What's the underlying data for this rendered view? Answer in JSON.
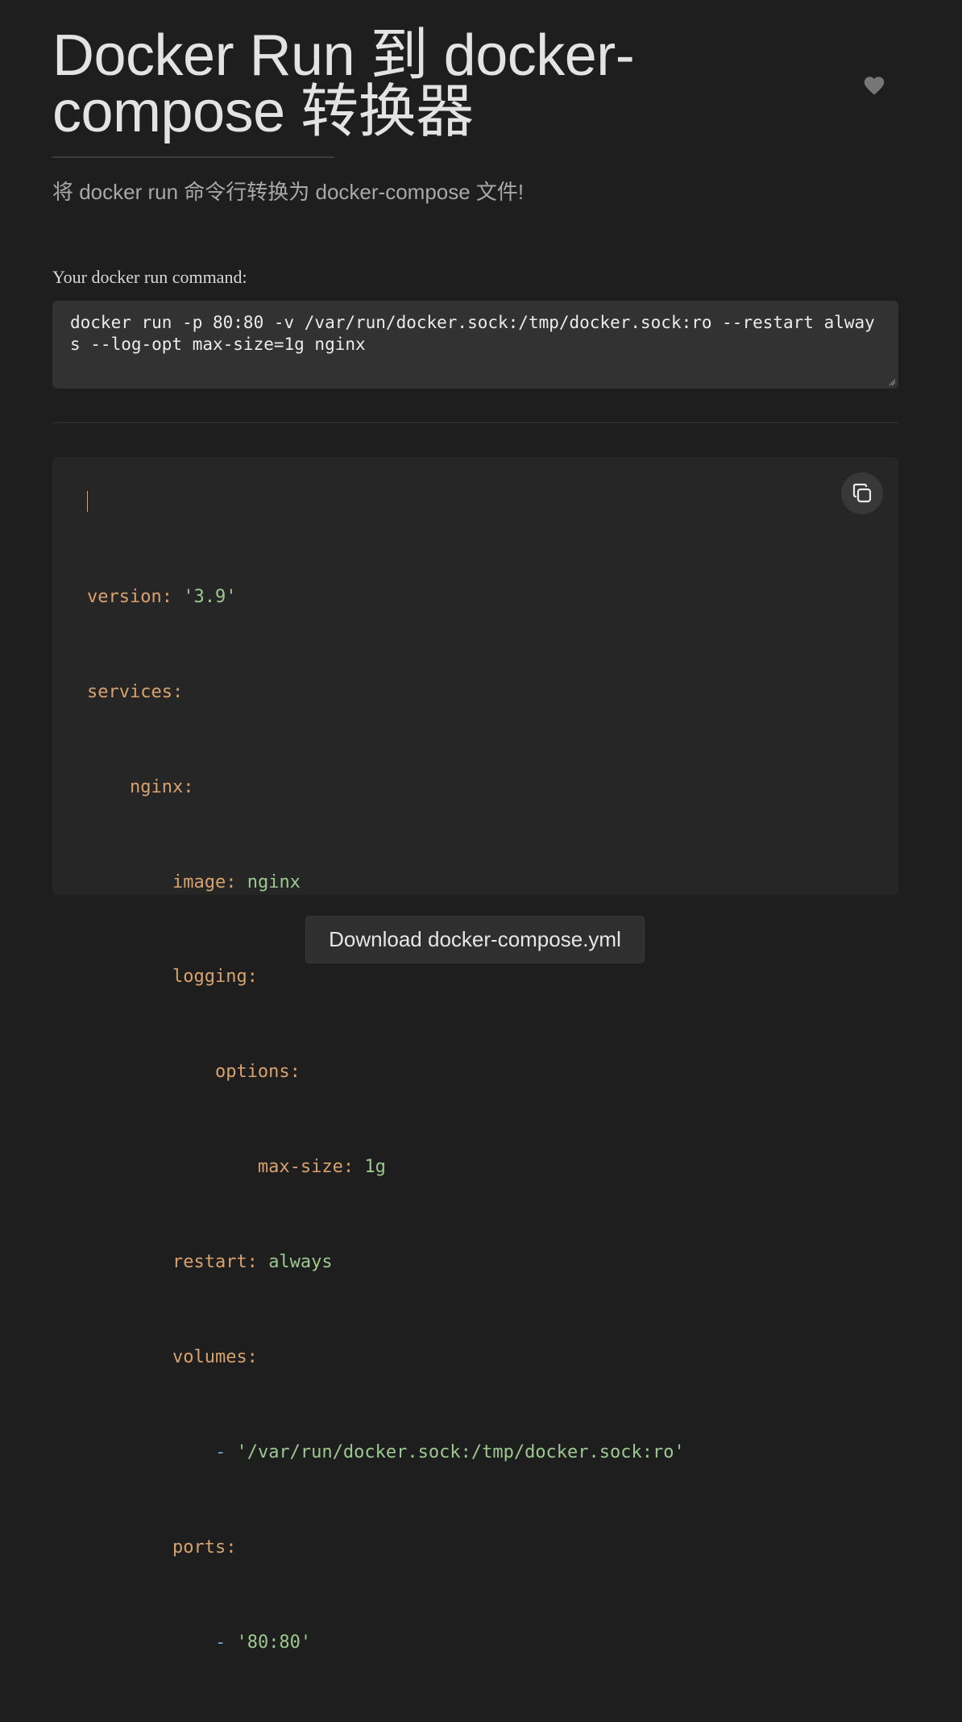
{
  "header": {
    "title": "Docker Run 到 docker-compose 转换器",
    "subtitle": "将 docker run 命令行转换为 docker-compose 文件!",
    "favorite_icon": "heart-icon"
  },
  "command": {
    "label": "Your docker run command:",
    "value": "docker run -p 80:80 -v /var/run/docker.sock:/tmp/docker.sock:ro --restart always --log-opt max-size=1g nginx"
  },
  "output": {
    "copy_icon": "copy-icon",
    "lines": [
      {
        "key": "version:",
        "value": "'3.9'"
      },
      {
        "key": "services:",
        "value": ""
      },
      {
        "key": "nginx:",
        "value": ""
      },
      {
        "key": "image:",
        "value": "nginx"
      },
      {
        "key": "logging:",
        "value": ""
      },
      {
        "key": "options:",
        "value": ""
      },
      {
        "key": "max-size:",
        "value": "1g"
      },
      {
        "key": "restart:",
        "value": "always"
      },
      {
        "key": "volumes:",
        "value": ""
      },
      {
        "dash": "-",
        "value": "'/var/run/docker.sock:/tmp/docker.sock:ro'"
      },
      {
        "key": "ports:",
        "value": ""
      },
      {
        "dash": "-",
        "value": "'80:80'"
      }
    ]
  },
  "actions": {
    "download_label": "Download docker-compose.yml"
  },
  "colors": {
    "background": "#1e1e1e",
    "yaml_key": "#d8a26f",
    "yaml_string": "#9cc98f",
    "yaml_dash": "#6aa7d8"
  }
}
